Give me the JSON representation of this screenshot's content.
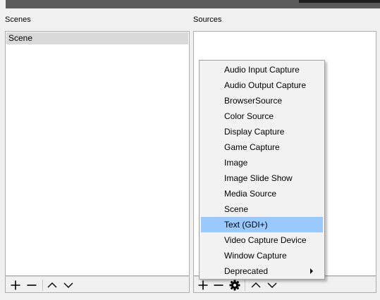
{
  "panels": {
    "scenes": {
      "title": "Scenes",
      "items": [
        "Scene"
      ]
    },
    "sources": {
      "title": "Sources"
    }
  },
  "toolbar_icons": {
    "add": "plus-icon",
    "remove": "minus-icon",
    "properties": "gear-icon",
    "move_up": "chevron-up-icon",
    "move_down": "chevron-down-icon"
  },
  "context_menu": {
    "items": [
      {
        "label": "Audio Input Capture"
      },
      {
        "label": "Audio Output Capture"
      },
      {
        "label": "BrowserSource"
      },
      {
        "label": "Color Source"
      },
      {
        "label": "Display Capture"
      },
      {
        "label": "Game Capture"
      },
      {
        "label": "Image"
      },
      {
        "label": "Image Slide Show"
      },
      {
        "label": "Media Source"
      },
      {
        "label": "Scene"
      },
      {
        "label": "Text (GDI+)",
        "highlighted": true
      },
      {
        "label": "Video Capture Device"
      },
      {
        "label": "Window Capture"
      },
      {
        "label": "Deprecated",
        "submenu": true
      }
    ]
  },
  "colors": {
    "background": "#f0f0f0",
    "selection": "#d9d9d9",
    "menu_highlight": "#99c9ff"
  }
}
